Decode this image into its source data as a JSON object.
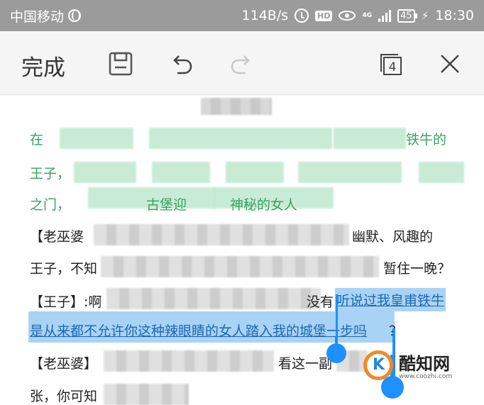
{
  "status": {
    "carrier": "中国移动",
    "speed": "114B/s",
    "hd": "HD",
    "network": "4G",
    "battery": "45",
    "time": "18:30"
  },
  "toolbar": {
    "done_label": "完成",
    "tabs_count": "4"
  },
  "document": {
    "line1": "在",
    "line1_end": "铁牛的",
    "line2": "王子，",
    "line3": "之门，",
    "line3_mid": "古堡迎",
    "line3_end": "神秘的女人",
    "line4": "【老巫婆",
    "line4_end": "幽默、风趣的",
    "line5": "王子，不知",
    "line5_end": "暂住一晚？",
    "line6_start": "【王子】:啊",
    "line6_mid": "没有",
    "line6_selected": "听说过我皇甫铁牛",
    "line7_selected": "是从来都不允许你这种辣眼睛的女人踏入我的城堡一步吗",
    "line7_end": "？",
    "line8": "【老巫婆】",
    "line8_end": "看这一副",
    "line9": "张，你可知"
  },
  "watermark": {
    "title": "酷知网",
    "url": "www.coozhi.com"
  }
}
